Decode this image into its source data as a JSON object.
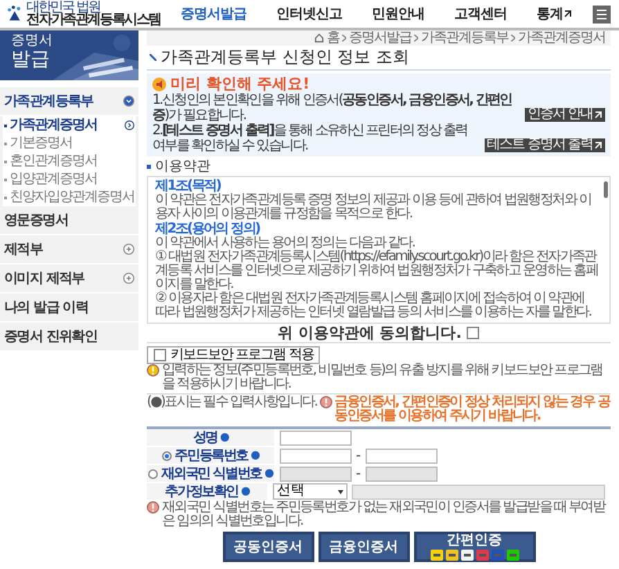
{
  "header": {
    "org": "대한민국 법원",
    "system": "전자가족관계등록시스템",
    "nav": [
      {
        "label": "증명서발급",
        "selected": true,
        "external": false
      },
      {
        "label": "인터넷신고",
        "selected": false,
        "external": false
      },
      {
        "label": "민원안내",
        "selected": false,
        "external": false
      },
      {
        "label": "고객센터",
        "selected": false,
        "external": false
      },
      {
        "label": "통계",
        "selected": false,
        "external": true
      }
    ]
  },
  "banner": {
    "caption": "증명서",
    "title": "발급"
  },
  "sidebar": {
    "items": [
      {
        "label": "가족관계등록부",
        "kind": "group",
        "expanded": true,
        "children": [
          {
            "label": "가족관계증명서",
            "selected": true
          },
          {
            "label": "기본증명서",
            "selected": false
          },
          {
            "label": "혼인관계증명서",
            "selected": false
          },
          {
            "label": "입양관계증명서",
            "selected": false
          },
          {
            "label": "친양자입양관계증명서",
            "selected": false
          }
        ]
      },
      {
        "label": "영문증명서",
        "kind": "link"
      },
      {
        "label": "제적부",
        "kind": "group",
        "expanded": false
      },
      {
        "label": "이미지 제적부",
        "kind": "group",
        "expanded": false
      },
      {
        "label": "나의 발급 이력",
        "kind": "link"
      },
      {
        "label": "증명서 진위확인",
        "kind": "link"
      }
    ]
  },
  "breadcrumb": [
    "홈",
    "증명서발급",
    "가족관계등록부",
    "가족관계증명서"
  ],
  "page_title": "가족관계등록부 신청인 정보 조회",
  "notice": {
    "title": "미리 확인해 주세요!",
    "items": [
      {
        "text": "1.신청인의 본인확인을 위해 인증서(**공동인증서, 금융인증서, 간편인증**)가 필요합니다.",
        "button": "인증서 안내"
      },
      {
        "text": "2.**[테스트 증명서 출력]**을 통해 소유하신 프린터의 정상 출력 여부를 확인하실 수 있습니다.",
        "button": "테스트 증명서 출력"
      }
    ]
  },
  "terms": {
    "heading": "이용약관",
    "paragraphs": [
      {
        "kind": "heading",
        "text": "제1조(목적)"
      },
      {
        "kind": "body",
        "text": "이 약관은 전자가족관계등록 증명 정보의 제공과 이용 등에 관하여 법원행정처와 이용자 사이의 이용관계를 규정함을 목적으로 한다."
      },
      {
        "kind": "heading",
        "text": "제2조(용어의 정의)"
      },
      {
        "kind": "body",
        "text": "이 약관에서 사용하는 용어의 정의는 다음과 같다."
      },
      {
        "kind": "body",
        "text": "① 대법원 전자가족관계등록시스템(https://efamily.scourt.go.kr)이라 함은 전자가족관계등록 서비스를 인터넷으로 제공하기 위하여 법원행정처가 구축하고 운영하는 홈페이지를 말한다."
      },
      {
        "kind": "body",
        "text": "② 이용자라 함은 대법원 전자가족관계등록시스템 홈페이지에 접속하여 이 약관에 따라 법원행정처가 제공하는 인터넷 열람발급 등의 서비스를 이용하는 자를 말한다."
      }
    ]
  },
  "agreement": {
    "label": "위 이용약관에 동의합니다.",
    "checked": false
  },
  "keyboard_security": {
    "label": "키보드보안 프로그램 적용",
    "checked": false,
    "hint": "입력하는 정보(주민등록번호, 비밀번호 등)의 유출 방지를 위해 키보드보안 프로그램을 적용하시기 바랍니다."
  },
  "required_note": "(●)표시는 필수 입력사항입니다.",
  "warning": "금융인증서, 간편인증이 정상 처리되지 않는 경우 공동인증서를 이용하여 주시기 바랍니다.",
  "form": {
    "rows": [
      {
        "kind": "text",
        "label": "성명",
        "mark": "●"
      },
      {
        "kind": "pair",
        "label": "주민등록번호",
        "mark": "●",
        "selected": true,
        "disabled": false,
        "separator": "-"
      },
      {
        "kind": "pair",
        "label": "재외국민 식별번호",
        "mark": "●",
        "selected": false,
        "disabled": true,
        "separator": "-"
      },
      {
        "kind": "select",
        "label": "추가정보확인",
        "mark": "●",
        "select": "선택"
      }
    ]
  },
  "footnote": "재외국민 식별번호는 주민등록번호가 없는 재외국민이 인증서를 발급받을 때 부여받은 임의의 식별번호입니다.",
  "buttons": [
    {
      "kind": "plain",
      "label": "공동인증서"
    },
    {
      "kind": "plain",
      "label": "금융인증서"
    },
    {
      "kind": "providers",
      "label": "간편인증"
    }
  ]
}
